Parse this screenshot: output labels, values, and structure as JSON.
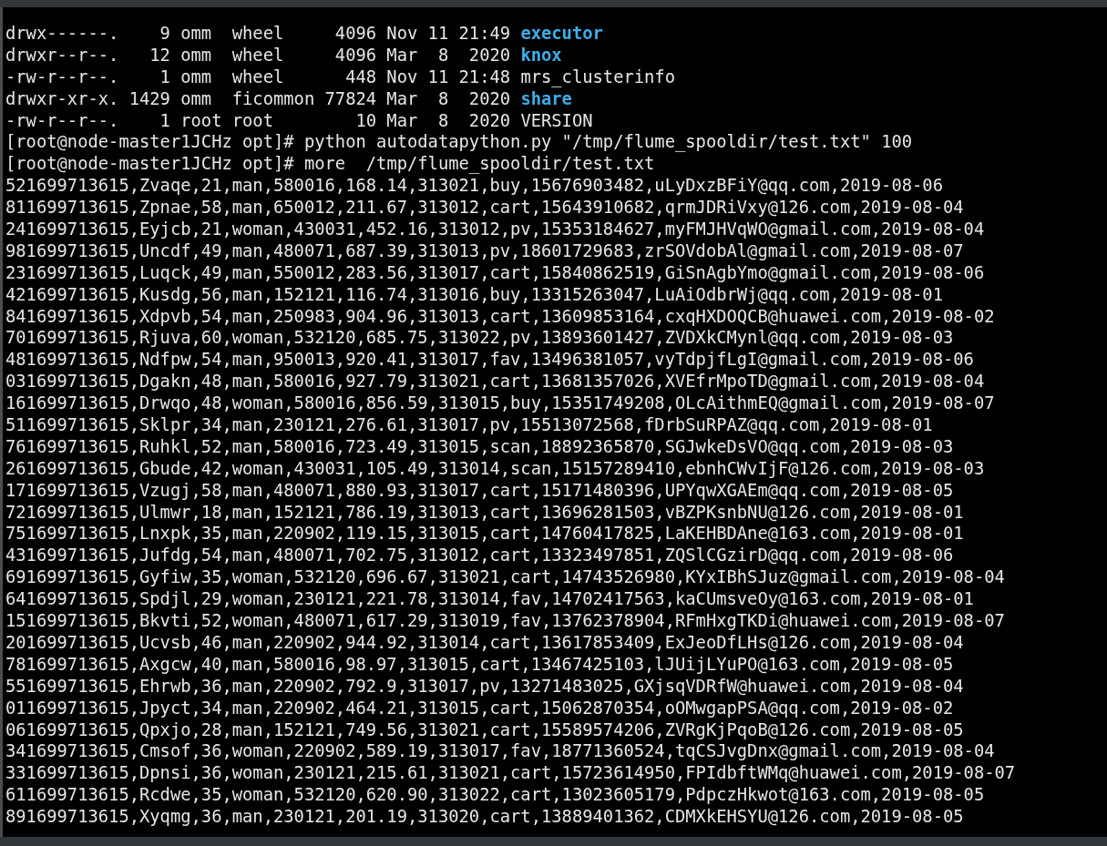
{
  "terminal": {
    "lines": [
      {
        "kind": "listing",
        "text": "drwx------.    9 omm  wheel     4096 Nov 11 21:49 ",
        "entry": "executor",
        "directory": true
      },
      {
        "kind": "listing",
        "text": "drwxr--r--.   12 omm  wheel     4096 Mar  8  2020 ",
        "entry": "knox",
        "directory": true
      },
      {
        "kind": "listing",
        "text": "-rw-r--r--.    1 omm  wheel      448 Nov 11 21:48 ",
        "entry": "mrs_clusterinfo",
        "directory": false
      },
      {
        "kind": "listing",
        "text": "drwxr-xr-x. 1429 omm  ficommon 77824 Mar  8  2020 ",
        "entry": "share",
        "directory": true
      },
      {
        "kind": "listing",
        "text": "-rw-r--r--.    1 root root        10 Mar  8  2020 ",
        "entry": "VERSION",
        "directory": false
      },
      {
        "kind": "command",
        "prompt": "[root@node-master1JCHz opt]#",
        "text": "python autodatapython.py \"/tmp/flume_spooldir/test.txt\" 100"
      },
      {
        "kind": "command",
        "prompt": "[root@node-master1JCHz opt]#",
        "text": "more  /tmp/flume_spooldir/test.txt"
      },
      {
        "kind": "output",
        "text": "521699713615,Zvaqe,21,man,580016,168.14,313021,buy,15676903482,uLyDxzBFiY@qq.com,2019-08-06"
      },
      {
        "kind": "output",
        "text": "811699713615,Zpnae,58,man,650012,211.67,313012,cart,15643910682,qrmJDRiVxy@126.com,2019-08-04"
      },
      {
        "kind": "output",
        "text": "241699713615,Eyjcb,21,woman,430031,452.16,313012,pv,15353184627,myFMJHVqWO@gmail.com,2019-08-04"
      },
      {
        "kind": "output",
        "text": "981699713615,Uncdf,49,man,480071,687.39,313013,pv,18601729683,zrSOVdobAl@gmail.com,2019-08-07"
      },
      {
        "kind": "output",
        "text": "231699713615,Luqck,49,man,550012,283.56,313017,cart,15840862519,GiSnAgbYmo@gmail.com,2019-08-06"
      },
      {
        "kind": "output",
        "text": "421699713615,Kusdg,56,man,152121,116.74,313016,buy,13315263047,LuAiOdbrWj@qq.com,2019-08-01"
      },
      {
        "kind": "output",
        "text": "841699713615,Xdpvb,54,man,250983,904.96,313013,cart,13609853164,cxqHXDOQCB@huawei.com,2019-08-02"
      },
      {
        "kind": "output",
        "text": "701699713615,Rjuva,60,woman,532120,685.75,313022,pv,13893601427,ZVDXkCMynl@qq.com,2019-08-03"
      },
      {
        "kind": "output",
        "text": "481699713615,Ndfpw,54,man,950013,920.41,313017,fav,13496381057,vyTdpjfLgI@gmail.com,2019-08-06"
      },
      {
        "kind": "output",
        "text": "031699713615,Dgakn,48,man,580016,927.79,313021,cart,13681357026,XVEfrMpoTD@gmail.com,2019-08-04"
      },
      {
        "kind": "output",
        "text": "161699713615,Drwqo,48,woman,580016,856.59,313015,buy,15351749208,OLcAithmEQ@gmail.com,2019-08-07"
      },
      {
        "kind": "output",
        "text": "511699713615,Sklpr,34,man,230121,276.61,313017,pv,15513072568,fDrbSuRPAZ@qq.com,2019-08-01"
      },
      {
        "kind": "output",
        "text": "761699713615,Ruhkl,52,man,580016,723.49,313015,scan,18892365870,SGJwkeDsVO@qq.com,2019-08-03"
      },
      {
        "kind": "output",
        "text": "261699713615,Gbude,42,woman,430031,105.49,313014,scan,15157289410,ebnhCWvIjF@126.com,2019-08-03"
      },
      {
        "kind": "output",
        "text": "171699713615,Vzugj,58,man,480071,880.93,313017,cart,15171480396,UPYqwXGAEm@qq.com,2019-08-05"
      },
      {
        "kind": "output",
        "text": "721699713615,Ulmwr,18,man,152121,786.19,313013,cart,13696281503,vBZPKsnbNU@126.com,2019-08-01"
      },
      {
        "kind": "output",
        "text": "751699713615,Lnxpk,35,man,220902,119.15,313015,cart,14760417825,LaKEHBDAne@163.com,2019-08-01"
      },
      {
        "kind": "output",
        "text": "431699713615,Jufdg,54,man,480071,702.75,313012,cart,13323497851,ZQSlCGzirD@qq.com,2019-08-06"
      },
      {
        "kind": "output",
        "text": "691699713615,Gyfiw,35,woman,532120,696.67,313021,cart,14743526980,KYxIBhSJuz@gmail.com,2019-08-04"
      },
      {
        "kind": "output",
        "text": "641699713615,Spdjl,29,woman,230121,221.78,313014,fav,14702417563,kaCUmsveOy@163.com,2019-08-01"
      },
      {
        "kind": "output",
        "text": "151699713615,Bkvti,52,woman,480071,617.29,313019,fav,13762378904,RFmHxgTKDi@huawei.com,2019-08-07"
      },
      {
        "kind": "output",
        "text": "201699713615,Ucvsb,46,man,220902,944.92,313014,cart,13617853409,ExJeoDfLHs@126.com,2019-08-04"
      },
      {
        "kind": "output",
        "text": "781699713615,Axgcw,40,man,580016,98.97,313015,cart,13467425103,lJUijLYuPO@163.com,2019-08-05"
      },
      {
        "kind": "output",
        "text": "551699713615,Ehrwb,36,man,220902,792.9,313017,pv,13271483025,GXjsqVDRfW@huawei.com,2019-08-04"
      },
      {
        "kind": "output",
        "text": "011699713615,Jpyct,34,man,220902,464.21,313015,cart,15062870354,oOMwgapPSA@qq.com,2019-08-02"
      },
      {
        "kind": "output",
        "text": "061699713615,Qpxjo,28,man,152121,749.56,313021,cart,15589574206,ZVRgKjPqoB@126.com,2019-08-05"
      },
      {
        "kind": "output",
        "text": "341699713615,Cmsof,36,woman,220902,589.19,313017,fav,18771360524,tqCSJvgDnx@gmail.com,2019-08-04"
      },
      {
        "kind": "output",
        "text": "331699713615,Dpnsi,36,woman,230121,215.61,313021,cart,15723614950,FPIdbftWMq@huawei.com,2019-08-07"
      },
      {
        "kind": "output",
        "text": "611699713615,Rcdwe,35,woman,532120,620.90,313022,cart,13023605179,PdpczHkwot@163.com,2019-08-05"
      },
      {
        "kind": "output",
        "text": "891699713615,Xyqmg,36,man,230121,201.19,313020,cart,13889401362,CDMXkEHSYU@126.com,2019-08-05"
      }
    ]
  }
}
